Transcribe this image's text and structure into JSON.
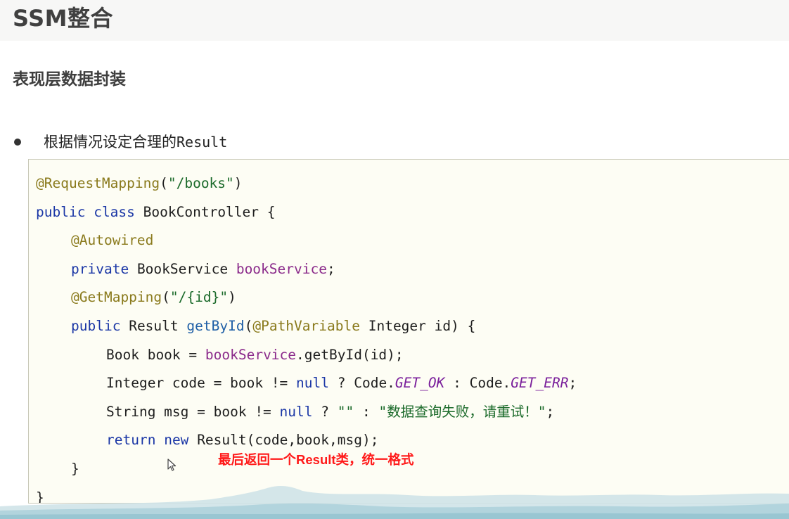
{
  "slide": {
    "title": "SSM整合",
    "section": "表现层数据封装",
    "bullet_text": "根据情况设定合理的",
    "bullet_code": "Result"
  },
  "code": {
    "l1_ann": "@RequestMapping",
    "l1_open": "(",
    "l1_str": "\"/books\"",
    "l1_close": ")",
    "l2_kw1": "public",
    "l2_kw2": "class",
    "l2_rest": "BookController {",
    "l3_ann": "@Autowired",
    "l4_kw": "private",
    "l4_type": "BookService",
    "l4_field": "bookService",
    "l4_end": ";",
    "l5_ann": "@GetMapping",
    "l5_open": "(",
    "l5_str": "\"/{id}\"",
    "l5_close": ")",
    "l6_kw": "public",
    "l6_type": "Result",
    "l6_fn": "getById",
    "l6_open": "(",
    "l6_ann": "@PathVariable",
    "l6_rest": "Integer id) {",
    "l7_a": "Book book = ",
    "l7_field": "bookService",
    "l7_b": ".getById(id);",
    "l8_a": "Integer code = book != ",
    "l8_null": "null",
    "l8_b": " ? Code.",
    "l8_c1": "GET_OK",
    "l8_c": " : Code.",
    "l8_c2": "GET_ERR",
    "l8_end": ";",
    "l9_a": "String msg = book != ",
    "l9_null": "null",
    "l9_b": " ? ",
    "l9_s1": "\"\"",
    "l9_c": " : ",
    "l9_s2": "\"数据查询失败，请重试！\"",
    "l9_end": ";",
    "l10_kw1": "return",
    "l10_kw2": "new",
    "l10_rest": "Result(code,book,msg);",
    "l11": "}",
    "l12": "}"
  },
  "annotation": "最后返回一个Result类，统一格式",
  "colors": {
    "annotation_text": "#ff1a1a",
    "code_background": "#fdfdf4",
    "keyword": "#1b37a6",
    "string": "#1b6a2a",
    "annotation_code": "#8a7a1c",
    "field": "#8b2b8b"
  },
  "icons": [
    "mouse-cursor-icon",
    "bullet-icon"
  ]
}
